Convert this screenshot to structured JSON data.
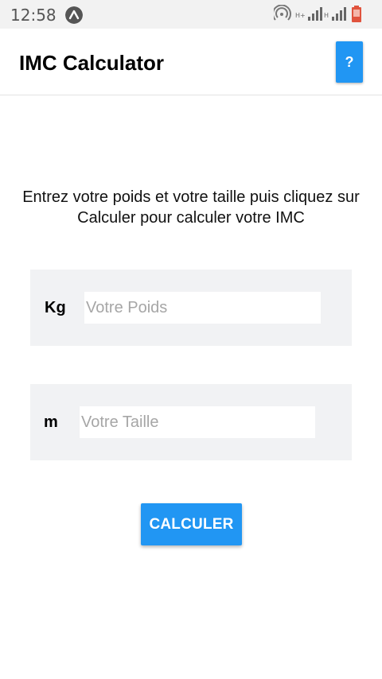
{
  "status_bar": {
    "time": "12:58",
    "network_labels": [
      "H+",
      "H"
    ],
    "icons": [
      "notification-a-icon",
      "hotspot-icon",
      "signal-icon",
      "signal-icon",
      "battery-icon"
    ]
  },
  "app_bar": {
    "title": "IMC Calculator",
    "help_label": "?"
  },
  "main": {
    "instructions": "Entrez votre poids et votre taille puis cliquez sur Calculer pour calculer votre IMC",
    "weight": {
      "unit": "Kg",
      "placeholder": "Votre Poids",
      "value": ""
    },
    "height": {
      "unit": "m",
      "placeholder": "Votre Taille",
      "value": ""
    },
    "calculate_label": "CALCULER"
  },
  "colors": {
    "accent": "#2196f3",
    "card_background": "#f1f2f4",
    "status_bar": "#f2f2f2",
    "battery": "#e0533d"
  }
}
